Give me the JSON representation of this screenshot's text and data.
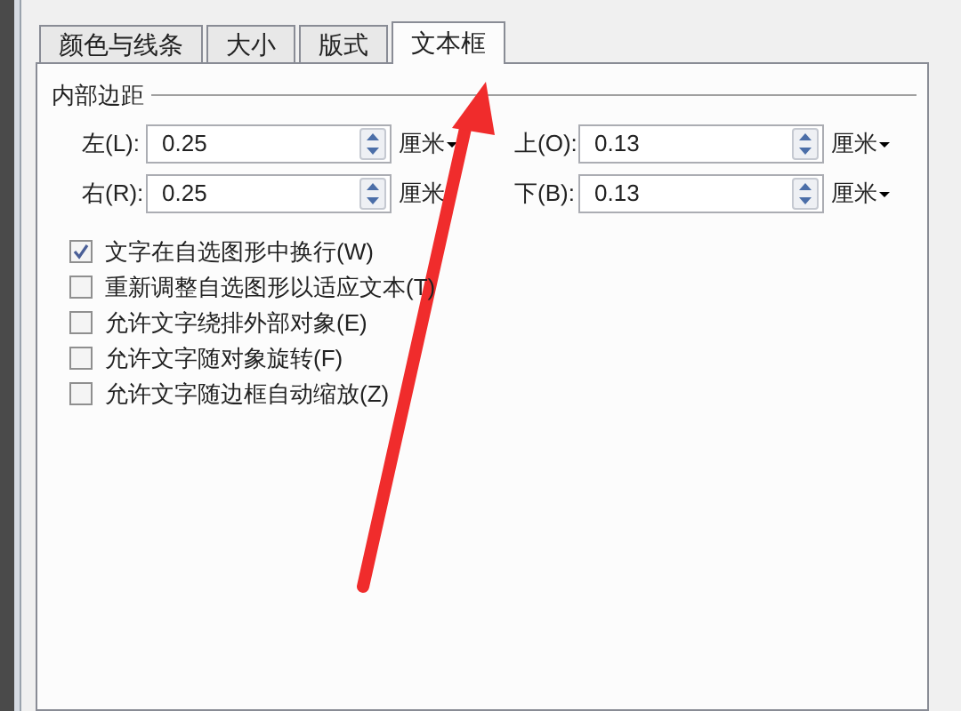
{
  "tabs": [
    {
      "label": "颜色与线条",
      "selected": false
    },
    {
      "label": "大小",
      "selected": false
    },
    {
      "label": "版式",
      "selected": false
    },
    {
      "label": "文本框",
      "selected": true
    }
  ],
  "margins": {
    "title": "内部边距",
    "fields": [
      {
        "label": "左(L):",
        "value": "0.25",
        "unit": "厘米"
      },
      {
        "label": "上(O):",
        "value": "0.13",
        "unit": "厘米"
      },
      {
        "label": "右(R):",
        "value": "0.25",
        "unit": "厘米"
      },
      {
        "label": "下(B):",
        "value": "0.13",
        "unit": "厘米"
      }
    ]
  },
  "options": [
    {
      "label": "文字在自选图形中换行(W)",
      "checked": true
    },
    {
      "label": "重新调整自选图形以适应文本(T)",
      "checked": false
    },
    {
      "label": "允许文字绕排外部对象(E)",
      "checked": false
    },
    {
      "label": "允许文字随对象旋转(F)",
      "checked": false
    },
    {
      "label": "允许文字随边框自动缩放(Z)",
      "checked": false
    }
  ]
}
